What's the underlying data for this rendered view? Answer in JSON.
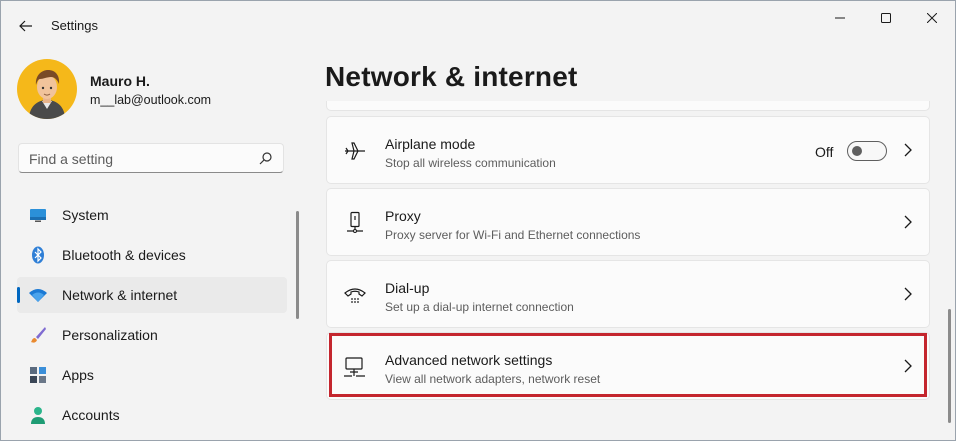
{
  "window": {
    "title": "Settings"
  },
  "user": {
    "name": "Mauro H.",
    "email": "m__lab@outlook.com"
  },
  "search": {
    "placeholder": "Find a setting"
  },
  "sidebar": {
    "items": [
      {
        "label": "System",
        "icon": "monitor-icon",
        "active": false
      },
      {
        "label": "Bluetooth & devices",
        "icon": "bluetooth-icon",
        "active": false
      },
      {
        "label": "Network & internet",
        "icon": "wifi-icon",
        "active": true
      },
      {
        "label": "Personalization",
        "icon": "brush-icon",
        "active": false
      },
      {
        "label": "Apps",
        "icon": "apps-icon",
        "active": false
      },
      {
        "label": "Accounts",
        "icon": "person-icon",
        "active": false
      }
    ]
  },
  "main": {
    "title": "Network & internet",
    "cards": [
      {
        "title": "Airplane mode",
        "desc": "Stop all wireless communication",
        "icon": "airplane-icon",
        "toggle": "Off"
      },
      {
        "title": "Proxy",
        "desc": "Proxy server for Wi-Fi and Ethernet connections",
        "icon": "proxy-icon"
      },
      {
        "title": "Dial-up",
        "desc": "Set up a dial-up internet connection",
        "icon": "phone-icon"
      },
      {
        "title": "Advanced network settings",
        "desc": "View all network adapters, network reset",
        "icon": "network-adapter-icon",
        "highlighted": true
      }
    ]
  },
  "colors": {
    "accent": "#0067c0",
    "highlight": "#c4262e",
    "background": "#f3f3f3"
  }
}
